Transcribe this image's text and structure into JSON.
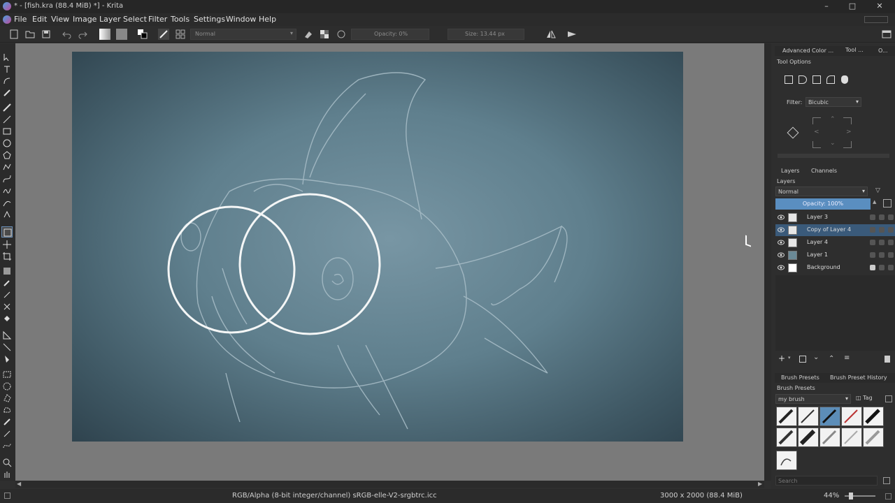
{
  "window": {
    "title": "* - [fish.kra (88.4 MiB) *] - Krita"
  },
  "menu": [
    "File",
    "Edit",
    "View",
    "Image",
    "Layer",
    "Select",
    "Filter",
    "Tools",
    "Settings",
    "Window",
    "Help"
  ],
  "toolbar": {
    "blend_mode": "Normal",
    "opacity_label": "Opacity: 0%",
    "size_label": "Size: 13.44 px"
  },
  "right_panel": {
    "top_tabs": [
      "Advanced Color ...",
      "Tool ...",
      "O..."
    ],
    "tool_options_title": "Tool Options",
    "filter_label": "Filter:",
    "filter_value": "Bicubic",
    "layer_tabs": [
      "Layers",
      "Channels"
    ],
    "layers_title": "Layers",
    "layer_blend": "Normal",
    "layer_opacity": "Opacity:  100%",
    "layers": [
      {
        "name": "Layer 3",
        "selected": false
      },
      {
        "name": "Copy of Layer 4",
        "selected": true
      },
      {
        "name": "Layer 4",
        "selected": false
      },
      {
        "name": "Layer 1",
        "selected": false
      },
      {
        "name": "Background",
        "selected": false
      }
    ],
    "brush_tabs": [
      "Brush Presets",
      "Brush Preset History"
    ],
    "brush_presets_title": "Brush Presets",
    "brush_tag": "my brush",
    "tag_label": "Tag",
    "search_placeholder": "Search"
  },
  "status": {
    "color_space": "RGB/Alpha (8-bit integer/channel)  sRGB-elle-V2-srgbtrc.icc",
    "dimensions": "3000 x 2000 (88.4 MiB)",
    "zoom": "44%"
  },
  "colors": {
    "accent": "#3a5a7a",
    "canvas_bg": "#5f7f8d"
  }
}
